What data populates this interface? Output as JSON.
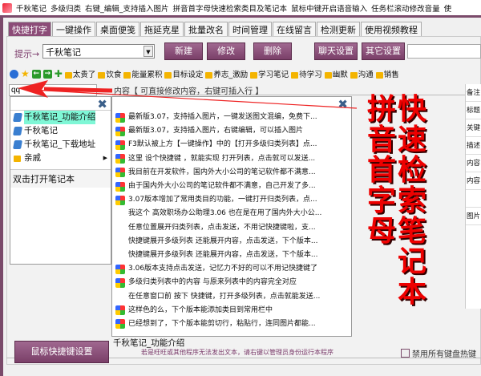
{
  "title": {
    "items": [
      "千秋笔记",
      "多级归类",
      "右键_编辑_支持插入图片",
      "拼音首字母快速检索类目及笔记本",
      "鼠标中键开启语音输入",
      "任务栏滚动修改音量",
      "使"
    ]
  },
  "tabs": [
    "快捷打字",
    "一键操作",
    "桌面便笺",
    "拖延克星",
    "批量改名",
    "时间管理",
    "在线留言",
    "检测更新",
    "使用视频教程"
  ],
  "prompt": {
    "label": "提示→",
    "value": "千秋笔记"
  },
  "buttons": {
    "new": "新建",
    "edit": "修改",
    "delete": "删除",
    "chat": "聊天设置",
    "other": "其它设置"
  },
  "toolbar_folders": [
    "太贵了",
    "饮食",
    "能量累积",
    "目标设定",
    "养志_激励",
    "学习笔记",
    "待学习",
    "幽默",
    "沟通",
    "销售"
  ],
  "search": {
    "value": "qq"
  },
  "bg_header": "内容【 可直接修改内容，右键可插入行 】",
  "left_popup": {
    "items": [
      {
        "label": "千秋笔记_功能介绍",
        "type": "book",
        "selected": true
      },
      {
        "label": "千秋笔记",
        "type": "book"
      },
      {
        "label": "千秋笔记_下载地址",
        "type": "book"
      },
      {
        "label": "亲戚",
        "type": "folder"
      }
    ],
    "status": "双击打开笔记本"
  },
  "right_popup": {
    "items": [
      {
        "text": "最新版3.07，支持插入图片，一键发送图文混编，免费下...",
        "icon": true
      },
      {
        "text": "最新版3.07，支持插入图片，右键编辑，可以插入图片",
        "icon": true
      },
      {
        "text": "F3默认被上方【一键操作】中的【打开多级归类列表】点...",
        "icon": true
      },
      {
        "text": "这里 设个快捷键 ，就能实现 打开列表，点击就可以发送...",
        "icon": true
      },
      {
        "text": "我目前在开发软件，国内外大小公司的笔记软件都不满意...",
        "icon": true
      },
      {
        "text": "由于国内外大小公司的笔记软件都不满意，自己开发了多...",
        "icon": true
      },
      {
        "text": "3.07版本增加了常用类目的功能，一键打开归类列表，点...",
        "icon": true
      },
      {
        "text": "我这个 高效职场办公助理3.06 也在是在用了国内外大小公...",
        "icon": false
      },
      {
        "text": "任意位置展开归类列表，点击发送，不用记快捷键啦，支...",
        "icon": false
      },
      {
        "text": "快捷键展开多级列表 还能展开内容，点击发送，下个版本...",
        "icon": false
      },
      {
        "text": "快捷键展开多级列表 还能展开内容，点击发送，下个版本...",
        "icon": false
      },
      {
        "text": "3.06版本支持点击发送，记忆力不好的可以不用记快捷键了",
        "icon": true
      },
      {
        "text": "多级归类列表中的内容 与原来列表中的内容完全对应",
        "icon": true
      },
      {
        "text": "在任意窗口前 按下 快捷键，打开多级列表，点击就能发送...",
        "icon": false
      },
      {
        "text": "这样色的么，下个版本能添加类目到常用栏中",
        "icon": true
      },
      {
        "text": "已经想到了，下个版本能剪切行，粘贴行，连同图片都能...",
        "icon": true
      }
    ],
    "status": "千秋笔记_功能介绍"
  },
  "overlay": {
    "left": [
      "拼",
      "音",
      "首",
      "字",
      "母"
    ],
    "right": [
      "快",
      "速",
      "检",
      "索",
      "笔",
      "记",
      "本"
    ]
  },
  "table_col": [
    "备注",
    "标题",
    "关键",
    "描述",
    "内容",
    "内容",
    "",
    "图片"
  ],
  "bottom": {
    "hotkey_button": "鼠标快捷键设置",
    "warning": "若是旺旺或其他程序无法发出文本，请右键以管理员身份运行本程序",
    "checkbox": "禁用所有键盘热键"
  },
  "colors": {
    "accent": "#7a3f68",
    "overlay": "#e00000",
    "selected": "#7ff7d6"
  }
}
